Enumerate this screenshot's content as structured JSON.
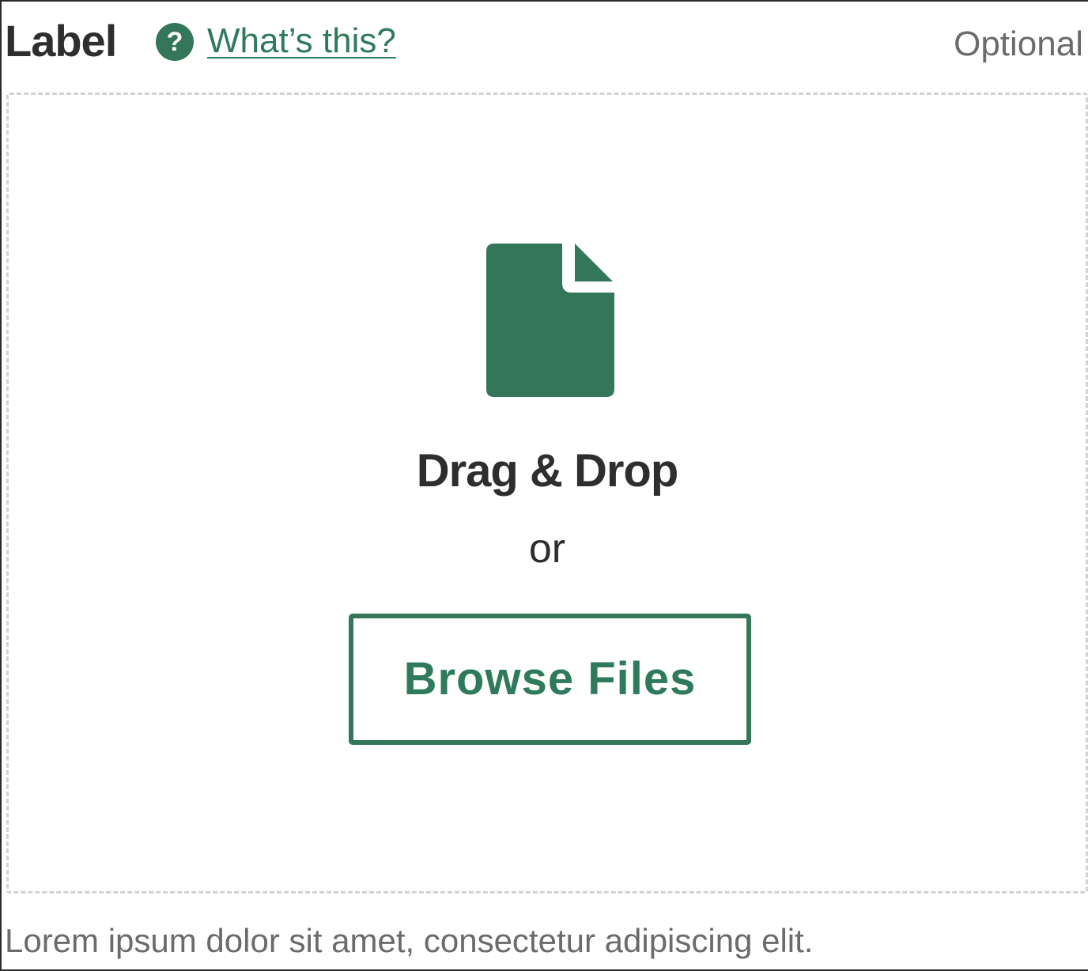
{
  "field": {
    "label": "Label",
    "help_icon_glyph": "?",
    "help_link": "What’s this?",
    "optional": "Optional",
    "hint": "Lorem ipsum dolor sit amet, consectetur adipiscing elit."
  },
  "dropzone": {
    "icon": "file-icon",
    "title": "Drag & Drop",
    "separator": "or",
    "browse_label": "Browse Files"
  },
  "colors": {
    "accent": "#34765a",
    "text": "#2e2e2e",
    "muted": "#6b6b6b",
    "dashed_border": "#d3d3d3"
  }
}
